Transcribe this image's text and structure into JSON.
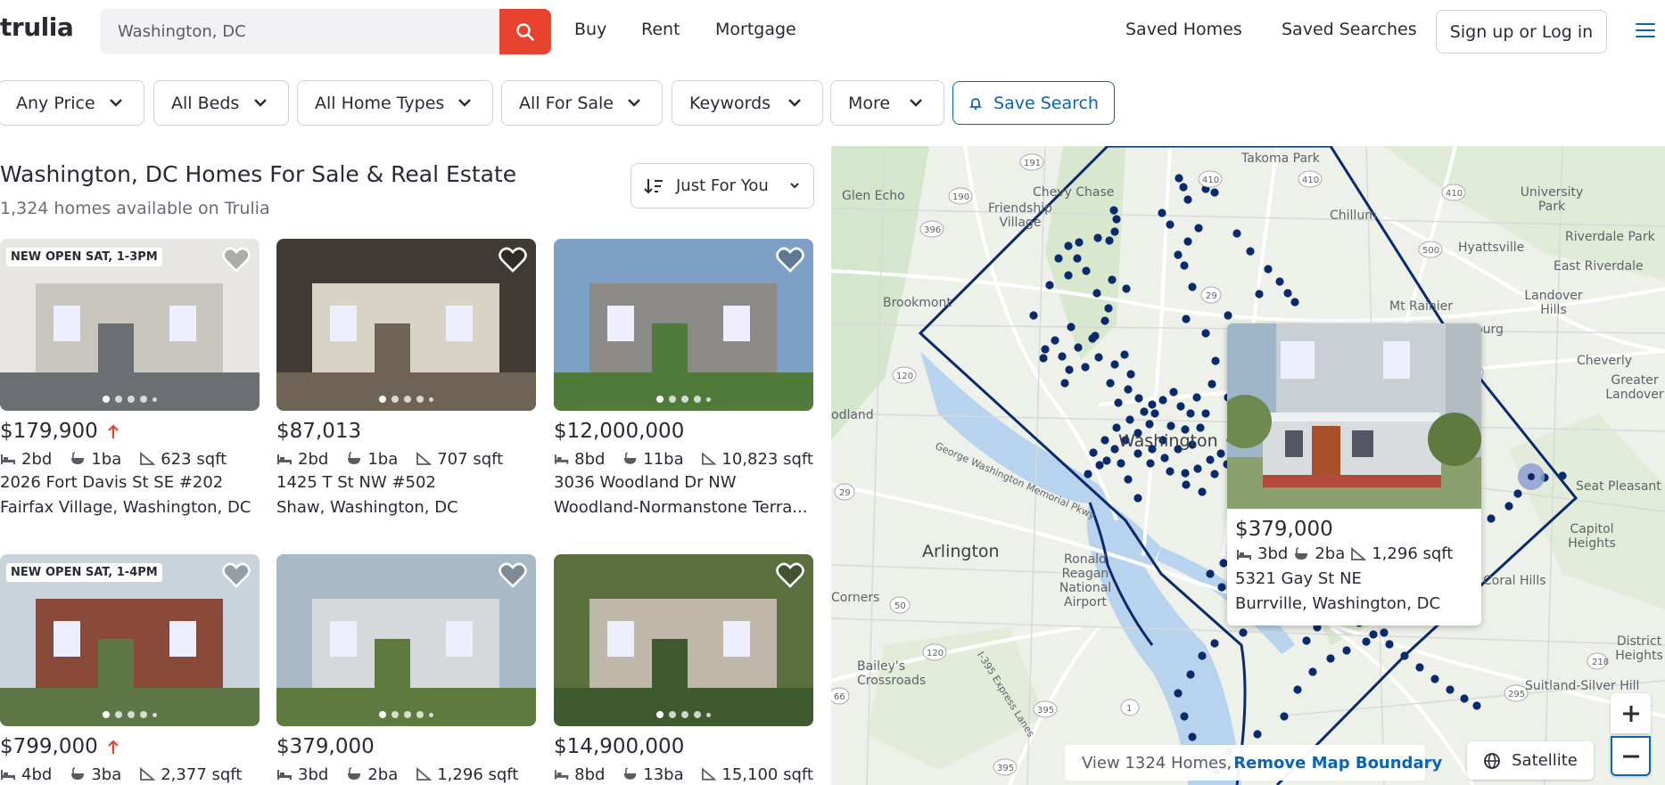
{
  "header": {
    "logo": "trulia",
    "search_value": "Washington, DC",
    "nav": [
      "Buy",
      "Rent",
      "Mortgage"
    ],
    "saved_homes": "Saved Homes",
    "saved_searches": "Saved Searches",
    "login": "Sign up or Log in"
  },
  "filters": {
    "price": "Any Price",
    "beds": "All Beds",
    "home_types": "All Home Types",
    "for_sale": "All For Sale",
    "keywords": "Keywords",
    "more": "More",
    "save_search": "Save Search"
  },
  "results": {
    "title": "Washington, DC Homes For Sale & Real Estate",
    "count": "1,324 homes available on Trulia",
    "sort": "Just For You"
  },
  "listings": [
    {
      "badges": [
        "NEW",
        "OPEN SAT, 1-3PM"
      ],
      "price": "$179,900",
      "price_up": true,
      "beds": "2bd",
      "baths": "1ba",
      "sqft": "623 sqft",
      "address": "2026 Fort Davis St SE #202",
      "location": "Fairfax Village, Washington, DC"
    },
    {
      "badges": [],
      "price": "$87,013",
      "price_up": false,
      "beds": "2bd",
      "baths": "1ba",
      "sqft": "707 sqft",
      "address": "1425 T St NW #502",
      "location": "Shaw, Washington, DC"
    },
    {
      "badges": [],
      "price": "$12,000,000",
      "price_up": false,
      "beds": "8bd",
      "baths": "11ba",
      "sqft": "10,823 sqft",
      "address": "3036 Woodland Dr NW",
      "location": "Woodland-Normanstone Terra..."
    },
    {
      "badges": [
        "NEW",
        "OPEN SAT, 1-4PM"
      ],
      "price": "$799,000",
      "price_up": true,
      "beds": "4bd",
      "baths": "3ba",
      "sqft": "2,377 sqft",
      "address": "",
      "location": ""
    },
    {
      "badges": [],
      "price": "$379,000",
      "price_up": false,
      "beds": "3bd",
      "baths": "2ba",
      "sqft": "1,296 sqft",
      "address": "",
      "location": ""
    },
    {
      "badges": [],
      "price": "$14,900,000",
      "price_up": false,
      "beds": "8bd",
      "baths": "13ba",
      "sqft": "15,100 sqft",
      "address": "",
      "location": ""
    }
  ],
  "map": {
    "popup": {
      "price": "$379,000",
      "beds": "3bd",
      "baths": "2ba",
      "sqft": "1,296 sqft",
      "address": "5321 Gay St NE",
      "location": "Burrville, Washington, DC"
    },
    "view_text": "View 1324 Homes,",
    "remove_boundary": "Remove Map Boundary",
    "satellite": "Satellite",
    "labels": {
      "takoma_park": "Takoma Park",
      "chevy_chase": "Chevy Chase",
      "glen_echo": "Glen Echo",
      "friendship_village": "Friendship Village",
      "chillum": "Chillum",
      "university_park": "University Park",
      "riverdale_park": "Riverdale Park",
      "east_riverdale": "East Riverdale",
      "hyattsville": "Hyattsville",
      "landover_hills": "Landover Hills",
      "mt_rainier": "Mt Rainier",
      "bladensburg": "Bladensburg",
      "brookmont": "Brookmont",
      "cheverly": "Cheverly",
      "greater_landover": "Greater Landover",
      "washington": "Washington",
      "seat_pleasant": "Seat Pleasant",
      "capitol_heights": "Capitol Heights",
      "arlington": "Arlington",
      "ronald_reagan_national_airport": "Ronald Reagan National Airport",
      "coral_hills": "Coral Hills",
      "baileys_crossroads": "Bailey's Crossroads",
      "district_heights": "District Heights",
      "suitland_silver_hill": "Suitland-Silver Hill",
      "odland": "odland",
      "corners": "Corners",
      "george_washington_memorial_pkwy": "George Washington Memorial Pkwy",
      "i_395_express_lanes": "I-395 Express Lanes"
    }
  }
}
